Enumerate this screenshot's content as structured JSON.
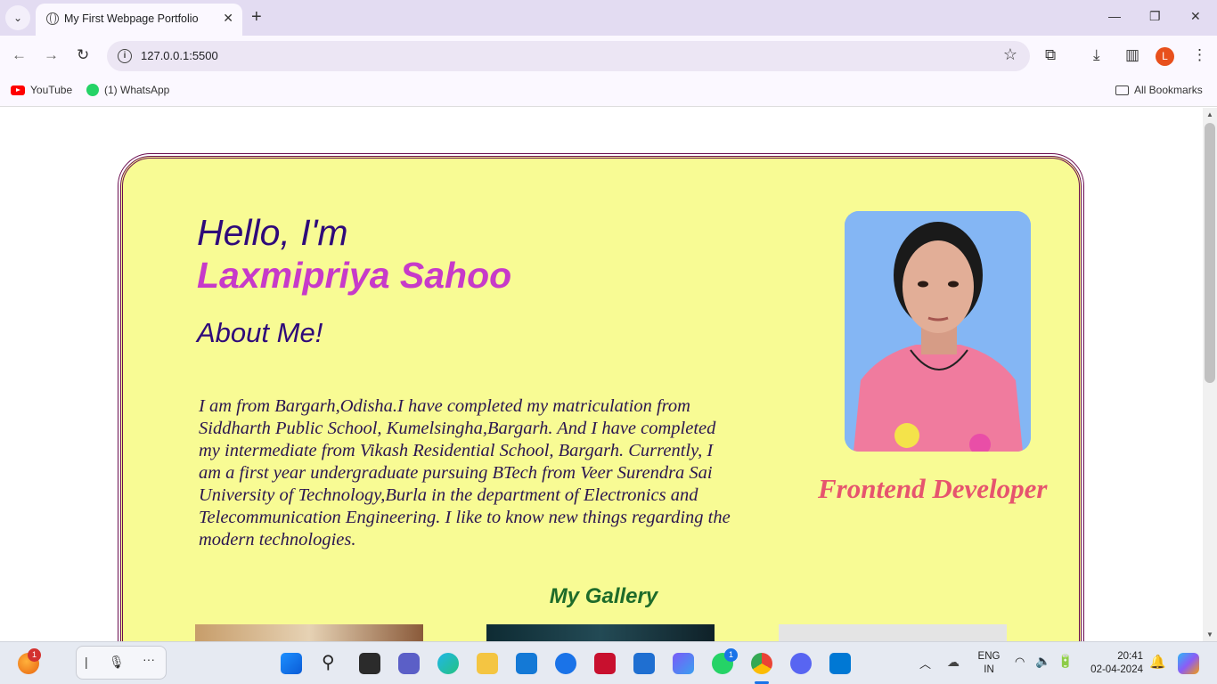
{
  "browser": {
    "tab_title": "My First Webpage Portfolio",
    "url": "127.0.0.1:5500",
    "profile_initial": "L",
    "bookmarks": [
      {
        "label": "YouTube",
        "icon": "youtube-icon"
      },
      {
        "label": "(1) WhatsApp",
        "icon": "whatsapp-icon"
      }
    ],
    "all_bookmarks_label": "All Bookmarks"
  },
  "page": {
    "greeting": "Hello, I'm",
    "name": "Laxmipriya Sahoo",
    "about_heading": "About Me!",
    "bio": "I am from Bargarh,Odisha.I have completed my matriculation from Siddharth Public School, Kumelsingha,Bargarh. And I have completed my intermediate from Vikash Residential School, Bargarh. Currently, I am a first year undergraduate pursuing BTech from Veer Surendra Sai University of Technology,Burla in the department of Electronics and Telecommunication Engineering. I like to know new things regarding the modern technologies.",
    "role": "Frontend Developer",
    "gallery_heading": "My Gallery",
    "colors": {
      "card_background": "#f8fb94",
      "card_border": "#6b0d4f",
      "heading": "#2f0a7a",
      "name": "#c73ac9",
      "role": "#e6546e",
      "gallery_heading": "#1e6b2a",
      "photo_background": "#84b6f4"
    }
  },
  "taskbar": {
    "widget_badge": "1",
    "whatsapp_badge": "1",
    "language_line1": "ENG",
    "language_line2": "IN",
    "time": "20:41",
    "date": "02-04-2024"
  }
}
